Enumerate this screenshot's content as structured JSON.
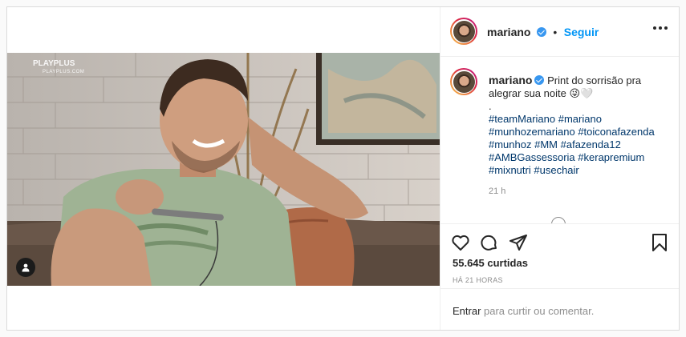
{
  "post": {
    "author": {
      "username": "mariano",
      "verified": true,
      "follow_label": "Seguir",
      "separator": "•"
    },
    "media": {
      "watermark_brand": "PLAYPLUS",
      "watermark_url": "PLAYPLUS.COM",
      "tag_icon": "user-tag-icon"
    },
    "caption": {
      "username": "mariano",
      "text": "Print do sorrisão pra alegrar sua noite 😜🤍",
      "dot": ".",
      "hashtags": [
        "#teamMariano",
        "#mariano",
        "#munhozemariano",
        "#toiconafazenda",
        "#munhoz",
        "#MM",
        "#afazenda12",
        "#AMBGassessoria",
        "#kerapremium",
        "#mixnutri",
        "#usechair"
      ],
      "time": "21 h"
    },
    "actions": {
      "like_icon": "heart-icon",
      "comment_icon": "comment-icon",
      "share_icon": "share-icon",
      "save_icon": "bookmark-icon"
    },
    "likes_text": "55.645 curtidas",
    "time_ago": "HÁ 21 HORAS",
    "comment_prompt": {
      "login_link": "Entrar",
      "rest": " para curtir ou comentar."
    }
  },
  "colors": {
    "accent": "#0095f6",
    "hashtag": "#00376b",
    "muted": "#8e8e8e",
    "border": "#dbdbdb"
  }
}
